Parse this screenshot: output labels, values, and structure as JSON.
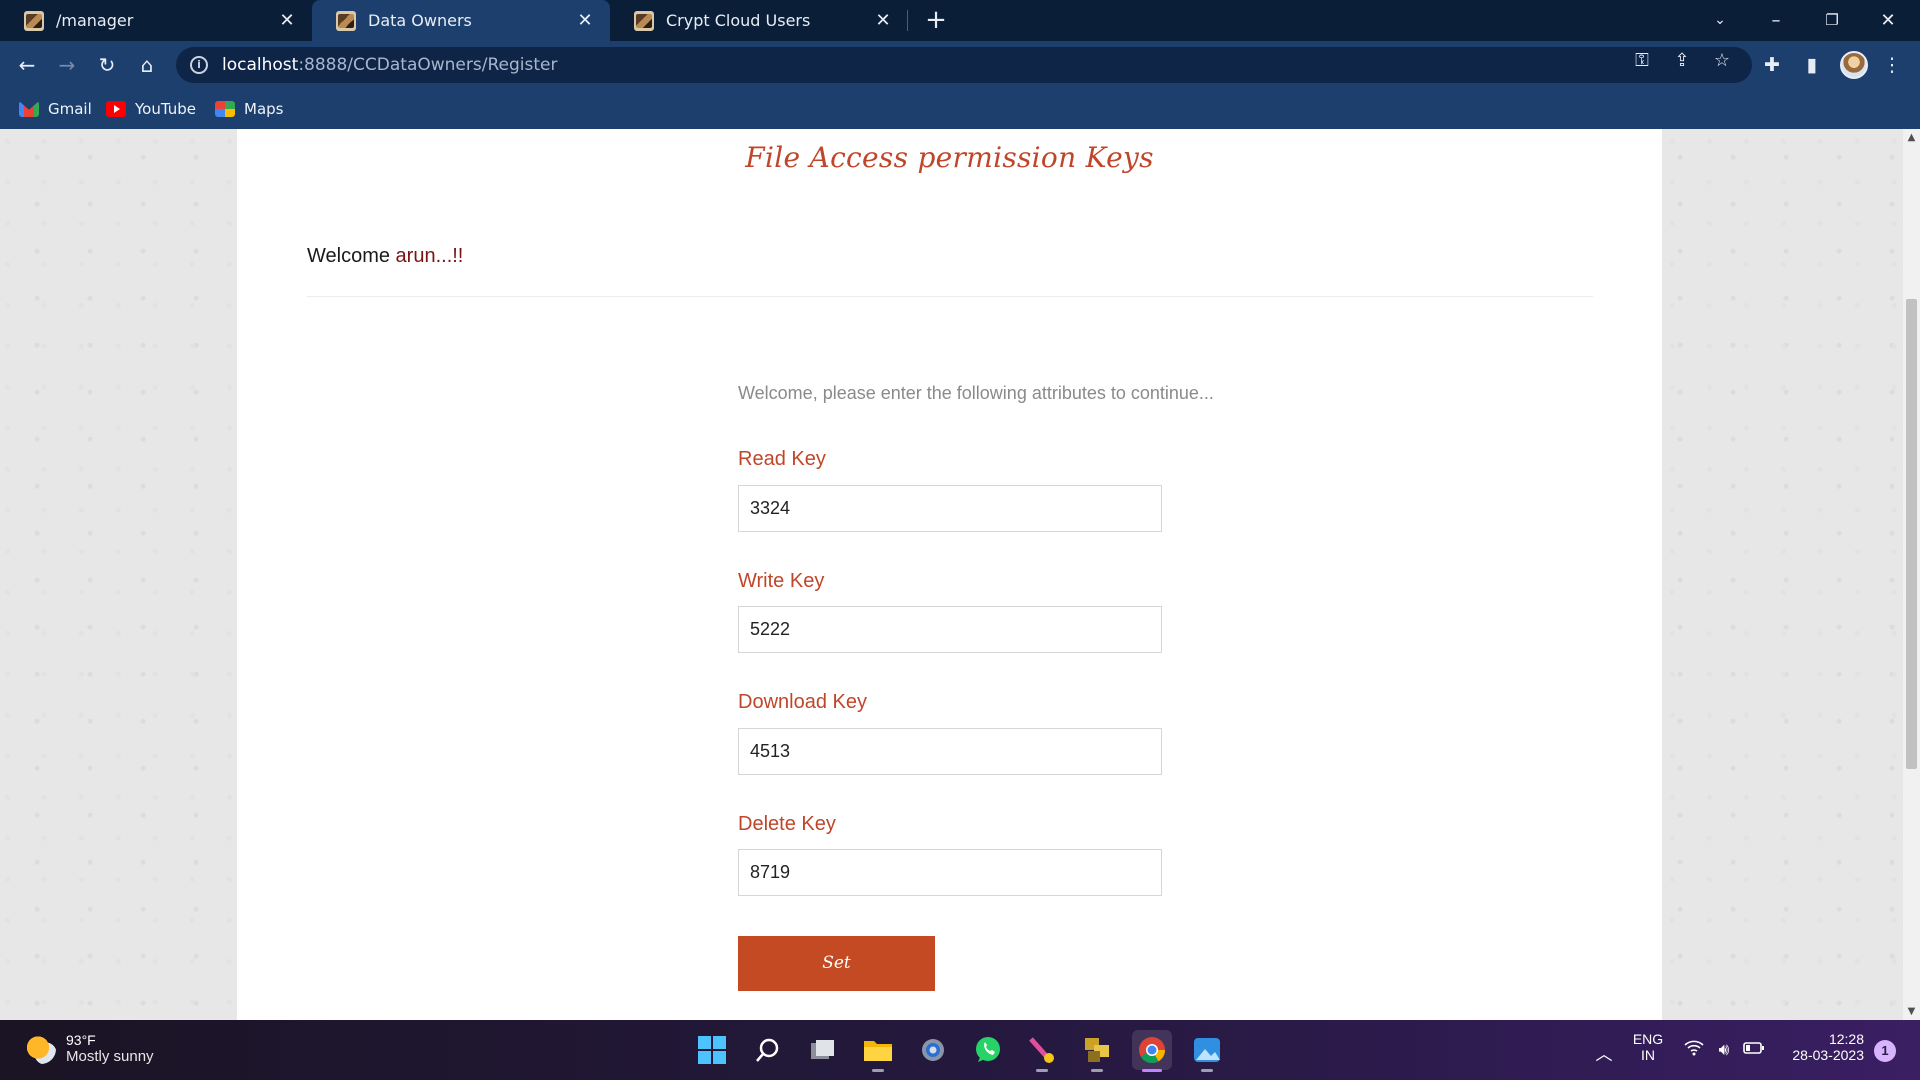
{
  "browser": {
    "tabs": [
      {
        "title": "/manager",
        "active": false
      },
      {
        "title": "Data Owners",
        "active": true
      },
      {
        "title": "Crypt Cloud Users",
        "active": false
      }
    ],
    "address": {
      "host": "localhost",
      "rest": ":8888/CCDataOwners/Register"
    },
    "bookmarks": [
      "Gmail",
      "YouTube",
      "Maps"
    ]
  },
  "page": {
    "title": "File Access permission Keys",
    "welcome_prefix": "Welcome ",
    "username": "arun...!!",
    "intro": "Welcome, please enter the following attributes to continue...",
    "fields": [
      {
        "label": "Read Key",
        "value": "3324"
      },
      {
        "label": "Write Key",
        "value": "5222"
      },
      {
        "label": "Download Key",
        "value": "4513"
      },
      {
        "label": "Delete Key",
        "value": "8719"
      }
    ],
    "submit_label": "Set"
  },
  "taskbar": {
    "weather": {
      "temp": "93°F",
      "condition": "Mostly sunny"
    },
    "apps": [
      "windows-start",
      "search",
      "task-view",
      "file-explorer",
      "settings",
      "whatsapp",
      "app-tool",
      "app-files",
      "chrome",
      "photos"
    ],
    "lang": "ENG",
    "region": "IN",
    "time": "12:28",
    "date": "28-03-2023",
    "notifications": "1"
  },
  "colors": {
    "accent": "#c0462a",
    "button": "#c44a24",
    "chrome_bg": "#1c3f6e"
  }
}
